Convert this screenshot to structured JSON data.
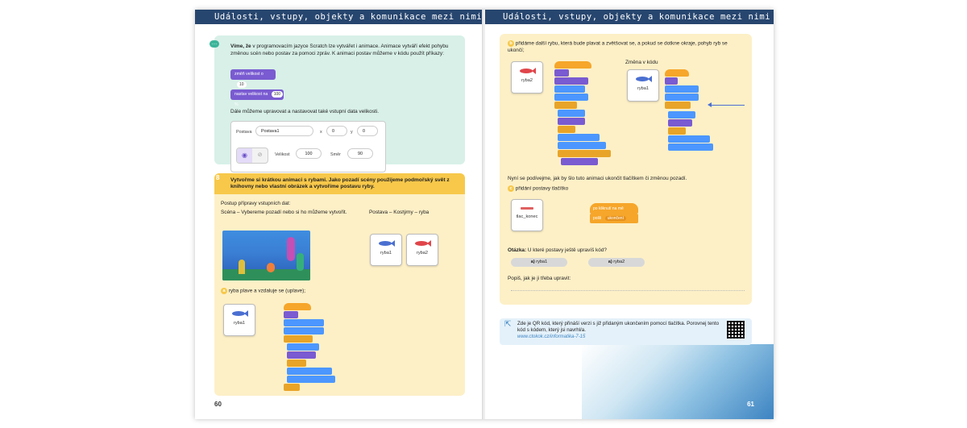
{
  "left_page": {
    "header": "Události, vstupy, objekty a komunikace mezi nimi",
    "page_number": "60",
    "info_box": {
      "intro_bold": "Víme, že",
      "intro_text": " v programovacím jazyce Scratch lze vytvářet i animace. Animace vytváří efekt pohybu změnou scén nebo postav za pomoci zpráv. K animaci postav můžeme v kódu použít příkazy:",
      "block1_label": "změň velikost o",
      "block1_value": "10",
      "block2_label": "nastav velikost na",
      "block2_value": "100",
      "block2_unit": "%",
      "middle_text": "Dále můžeme upravovat a nastavovat také vstupní data velikosti.",
      "panel": {
        "postava_label": "Postava",
        "postava_value": "Postava1",
        "x_label": "x",
        "x_value": "0",
        "y_label": "y",
        "y_value": "0",
        "velikost_label": "Velikost",
        "velikost_value": "100",
        "smer_label": "Směr",
        "smer_value": "90"
      }
    },
    "task8": {
      "number": "8",
      "title": "Vytvořme si krátkou animaci s rybami. Jako pozadí scény použijeme podmořský svět z knihovny nebo vlastní obrázek a vytvoříme postavu ryby.",
      "prep_title": "Postup přípravy vstupních dat:",
      "scene_text": "Scéna – Vybereme pozadí nebo si ho můžeme vytvořit.",
      "costume_text": "Postava – Kostýmy – ryba",
      "sprite1": "ryba1",
      "sprite2": "ryba2",
      "step_a_letter": "a",
      "step_a_text": "ryba plave a vzdaluje se (uplave);",
      "step_a_sprite": "ryba1"
    }
  },
  "right_page": {
    "header": "Události, vstupy, objekty a komunikace mezi nimi",
    "page_number": "61",
    "step_b_letter": "b",
    "step_b_text": "přidáme další rybu, která bude plavat a zvětšovat se, a pokud se dotkne okraje, pohyb ryb se ukončí;",
    "sprite_ryba2": "ryba2",
    "change_label": "Změna v kódu",
    "sprite_ryba1": "ryba1",
    "end_text": "Nyní se podívejme, jak by šlo tuto animaci ukončit tlačítkem či změnou pozadí.",
    "step_c_letter": "c",
    "step_c_text": "přidání postavy tlačítko",
    "sprite_button": "tlac_konec",
    "hat_label": "po kliknutí na mě",
    "broadcast_label": "pošli",
    "broadcast_value": "ukončení",
    "question_bold": "Otázka:",
    "question_text": " U které postavy ještě upravíš kód?",
    "answer_a_letter": "a)",
    "answer_a": " ryba1",
    "answer_b_letter": "a)",
    "answer_b": " ryba2",
    "describe_text": "Popiš, jak je ji třeba upravit:",
    "qr_text": "Zde je QR kód, který přináší verzi s již přidaným ukončením pomocí tlačítka. Porovnej tento kód s kódem, který jsi navrhl/a.",
    "qr_link": "www.ctokok.cz/informatika-7-15"
  },
  "colors": {
    "header_bg": "#27466f",
    "green_box": "#d8f0e8",
    "yellow_box": "#fdf0c7",
    "yellow_bar": "#f7c84a",
    "scratch_purple": "#7a5bd1",
    "scratch_blue": "#4c97ff",
    "scratch_orange": "#f6a62a"
  }
}
